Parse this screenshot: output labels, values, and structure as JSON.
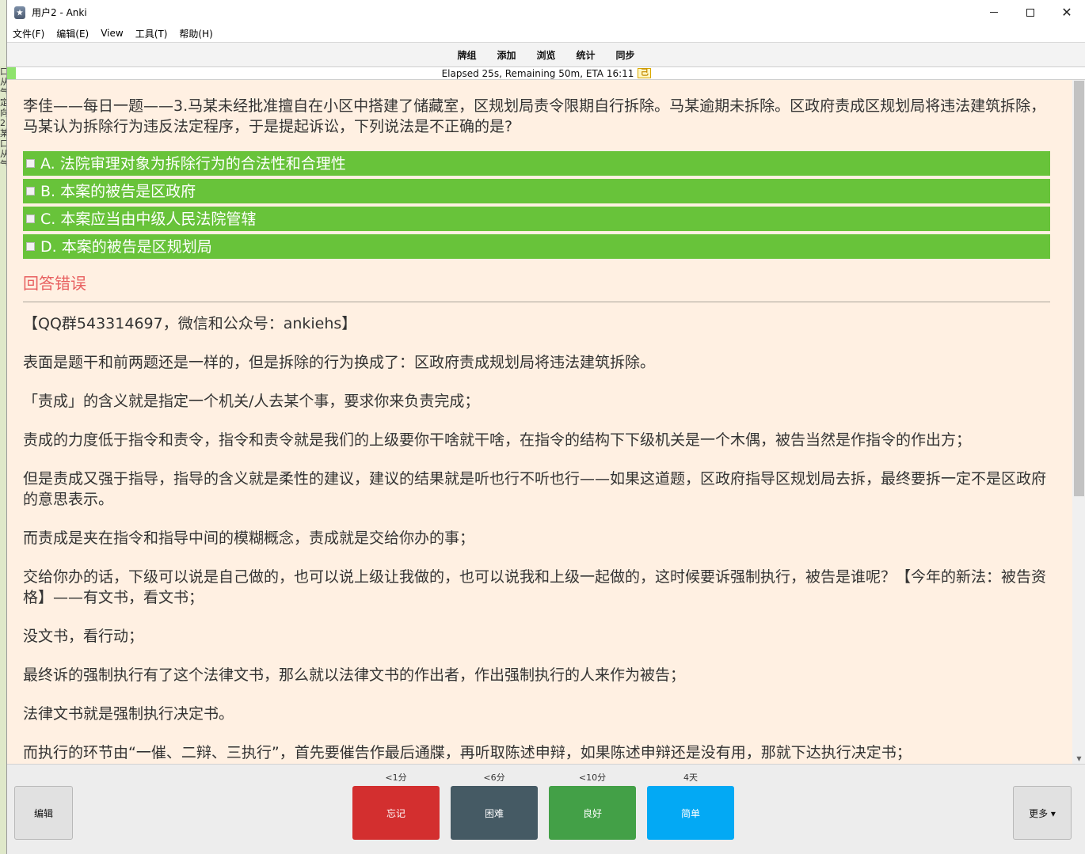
{
  "left_strip": {
    "chars": [
      "口",
      "从",
      "气",
      "定",
      "向",
      "2",
      "某",
      "口",
      "从",
      "气"
    ]
  },
  "window": {
    "title": "用户2 - Anki",
    "controls": {
      "minimize": "—",
      "maximize": "☐",
      "close": "✕"
    }
  },
  "menu": {
    "items": [
      "文件(F)",
      "编辑(E)",
      "View",
      "工具(T)",
      "帮助(H)"
    ]
  },
  "toolbar": {
    "links": [
      "牌组",
      "添加",
      "浏览",
      "统计",
      "同步"
    ]
  },
  "status": {
    "text": "Elapsed 25s, Remaining 50m, ETA 16:11",
    "icon": "timer-icon",
    "icon_glyph": "己",
    "progress_fraction": 0.008
  },
  "card": {
    "question": "李佳——每日一题——3.马某未经批准擅自在小区中搭建了储藏室，区规划局责令限期自行拆除。马某逾期未拆除。区政府责成区规划局将违法建筑拆除，马某认为拆除行为违反法定程序，于是提起诉讼，下列说法是不正确的是?",
    "options": [
      "A. 法院审理对象为拆除行为的合法性和合理性",
      "B. 本案的被告是区政府",
      "C. 本案应当由中级人民法院管辖",
      "D. 本案的被告是区规划局"
    ],
    "option_color": "#68c33a",
    "result": "回答错误",
    "result_color": "#e86060",
    "explanation": [
      "【QQ群543314697，微信和公众号：ankiehs】",
      "表面是题干和前两题还是一样的，但是拆除的行为换成了：区政府责成规划局将违法建筑拆除。",
      "「责成」的含义就是指定一个机关/人去某个事，要求你来负责完成；",
      "责成的力度低于指令和责令，指令和责令就是我们的上级要你干啥就干啥，在指令的结构下下级机关是一个木偶，被告当然是作指令的作出方；",
      "但是责成又强于指导，指导的含义就是柔性的建议，建议的结果就是听也行不听也行——如果这道题，区政府指导区规划局去拆，最终要拆一定不是区政府的意思表示。",
      "而责成是夹在指令和指导中间的模糊概念，责成就是交给你办的事；",
      "交给你办的话，下级可以说是自己做的，也可以说上级让我做的，也可以说我和上级一起做的，这时候要诉强制执行，被告是谁呢？【今年的新法：被告资格】——有文书，看文书；",
      "没文书，看行动；",
      "最终诉的强制执行有了这个法律文书，那么就以法律文书的作出者，作出强制执行的人来作为被告；",
      "法律文书就是强制执行决定书。",
      "而执行的环节由“一催、二辩、三执行”，首先要催告作最后通牒，再听取陈述申辩，如果陈述申辩还是没有用，那就下达执行决定书；"
    ]
  },
  "bottom": {
    "edit_label": "编辑",
    "more_label": "更多 ▾",
    "ease": [
      {
        "time": "<1分",
        "label": "忘记",
        "color": "#d32f2f"
      },
      {
        "time": "<6分",
        "label": "困难",
        "color": "#455a64"
      },
      {
        "time": "<10分",
        "label": "良好",
        "color": "#43a047"
      },
      {
        "time": "4天",
        "label": "简单",
        "color": "#03a9f4"
      }
    ]
  }
}
